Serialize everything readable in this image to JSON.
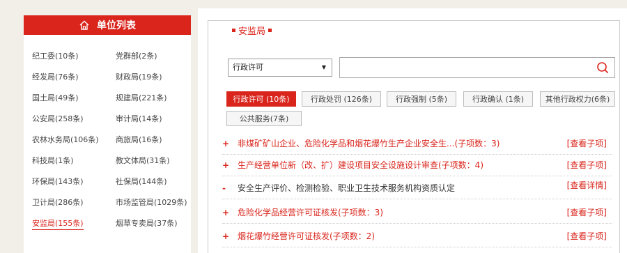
{
  "left_panel": {
    "title": "单位列表",
    "departments": [
      {
        "label": "纪工委(10条)"
      },
      {
        "label": "党群部(2条)"
      },
      {
        "label": "经发局(76条)"
      },
      {
        "label": "财政局(19条)"
      },
      {
        "label": "国土局(49条)"
      },
      {
        "label": "规建局(221条)"
      },
      {
        "label": "公安局(258条)"
      },
      {
        "label": "审计局(14条)"
      },
      {
        "label": "农林水务局(106条)"
      },
      {
        "label": "商旅局(16条)"
      },
      {
        "label": "科技局(1条)"
      },
      {
        "label": "教文体局(31条)"
      },
      {
        "label": "环保局(143条)"
      },
      {
        "label": "社保局(144条)"
      },
      {
        "label": "卫计局(286条)"
      },
      {
        "label": "市场监管局(1029条)"
      },
      {
        "label": "安监局(155条)"
      },
      {
        "label": "烟草专卖局(37条)"
      }
    ],
    "active_department": "安监局(155条)"
  },
  "right_panel": {
    "section_title": "安监局",
    "filter": {
      "selected": "行政许可"
    },
    "search": {
      "value": ""
    },
    "tabs": [
      {
        "label": "行政许可 (10条)",
        "active": true
      },
      {
        "label": "行政处罚 (126条)",
        "active": false
      },
      {
        "label": "行政强制 (5条)",
        "active": false
      },
      {
        "label": "行政确认 (1条)",
        "active": false
      },
      {
        "label": "其他行政权力(6条)",
        "active": false
      },
      {
        "label": "公共服务(7条)",
        "active": false
      }
    ],
    "items": [
      {
        "sign": "+",
        "text": "非煤矿矿山企业、危险化学品和烟花爆竹生产企业安全生...(子项数：3)",
        "action": "[查看子项]",
        "style": "red"
      },
      {
        "sign": "+",
        "text": "生产经营单位新（改、扩）建设项目安全设施设计审查(子项数：4)",
        "action": "[查看子项]",
        "style": "red"
      },
      {
        "sign": "-",
        "text": "安全生产评价、检测检验、职业卫生技术服务机构资质认定",
        "action": "[查看详情]",
        "style": "black"
      },
      {
        "sign": "+",
        "text": "危险化学品经营许可证核发(子项数：3)",
        "action": "[查看子项]",
        "style": "red"
      },
      {
        "sign": "+",
        "text": "烟花爆竹经营许可证核发(子项数：2)",
        "action": "[查看子项]",
        "style": "red"
      }
    ]
  },
  "colors": {
    "accent": "#d9251c"
  }
}
